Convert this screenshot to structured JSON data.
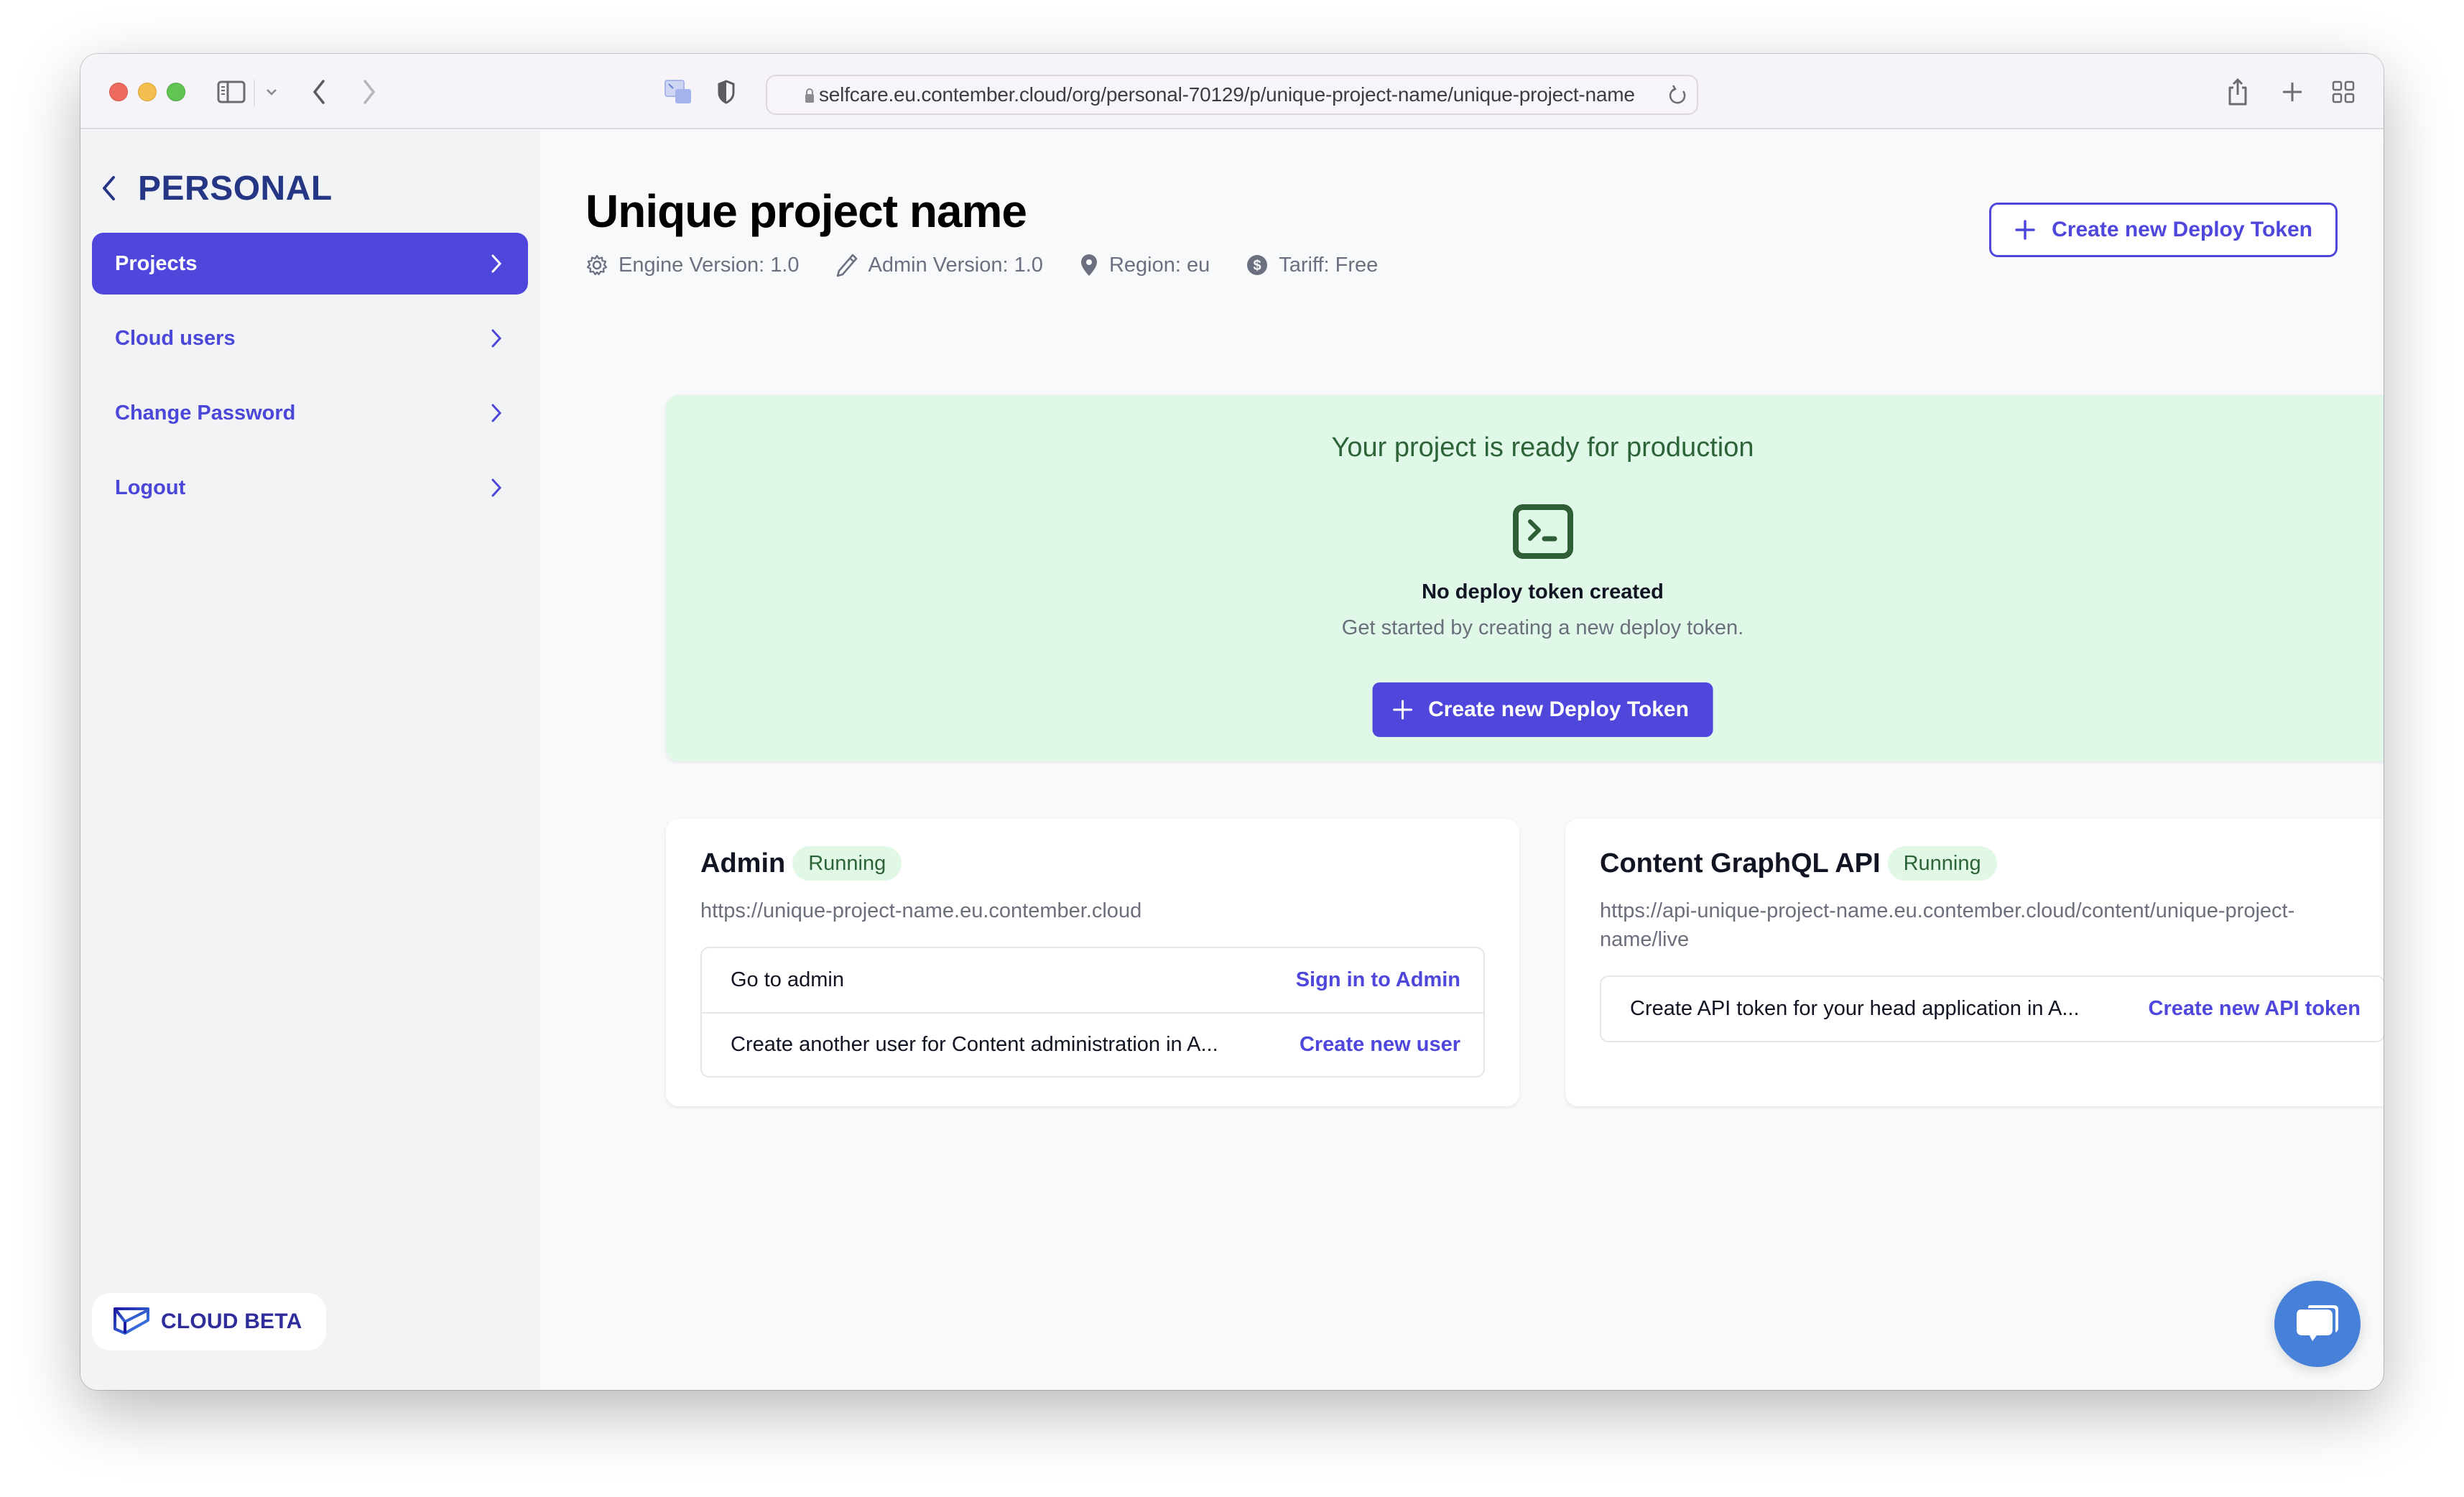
{
  "browser": {
    "url": "selfcare.eu.contember.cloud/org/personal-70129/p/unique-project-name/unique-project-name",
    "icons": [
      "sidebar-toggle-icon",
      "chevron-down-icon",
      "back-icon",
      "forward-icon",
      "picture-in-picture-icon",
      "privacy-shield-icon",
      "lock-icon",
      "reload-icon",
      "share-icon",
      "new-tab-icon",
      "tab-overview-icon"
    ]
  },
  "sidebar": {
    "org_title": "PERSONAL",
    "items": [
      {
        "label": "Projects",
        "active": true
      },
      {
        "label": "Cloud users",
        "active": false
      },
      {
        "label": "Change Password",
        "active": false
      },
      {
        "label": "Logout",
        "active": false
      }
    ],
    "footer_label": "CLOUD BETA"
  },
  "header": {
    "title": "Unique project name",
    "meta": {
      "engine": "Engine Version: 1.0",
      "admin": "Admin Version: 1.0",
      "region": "Region: eu",
      "tariff": "Tariff: Free"
    },
    "create_token_button": "Create new Deploy Token"
  },
  "ready_panel": {
    "title": "Your project is ready for production",
    "empty_title": "No deploy token created",
    "empty_subtitle": "Get started by creating a new deploy token.",
    "button_label": "Create new Deploy Token"
  },
  "cards": {
    "admin": {
      "title": "Admin",
      "status": "Running",
      "url": "https://unique-project-name.eu.contember.cloud",
      "actions": [
        {
          "description": "Go to admin",
          "link": "Sign in to Admin"
        },
        {
          "description": "Create another user for Content administration in A...",
          "link": "Create new user"
        }
      ]
    },
    "api": {
      "title": "Content GraphQL API",
      "status": "Running",
      "url": "https://api-unique-project-name.eu.contember.cloud/content/unique-project-name/live",
      "actions": [
        {
          "description": "Create API token for your head application in A...",
          "link": "Create new API token"
        }
      ]
    }
  },
  "colors": {
    "accent": "#4f47dc",
    "org_title": "#253685",
    "success_bg": "#e0f8e8",
    "success_text": "#2c6438",
    "chat_button": "#4680d8"
  }
}
